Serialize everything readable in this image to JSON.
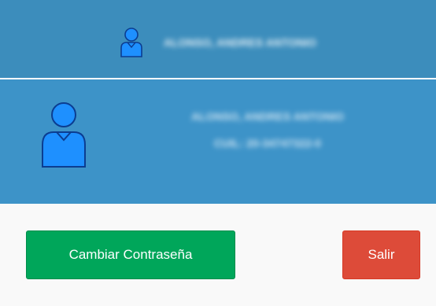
{
  "navbar": {
    "user_name": "ALONSO, ANDRES ANTONIO",
    "avatar_icon": "user-icon"
  },
  "user_header": {
    "name": "ALONSO, ANDRES ANTONIO",
    "cuil": "CUIL: 20-34747322-0",
    "avatar_icon": "user-icon"
  },
  "footer": {
    "change_password_label": "Cambiar Contraseña",
    "logout_label": "Salir"
  },
  "colors": {
    "navbar": "#3c8dbc",
    "header": "#3d93c8",
    "success": "#00a65a",
    "danger": "#dd4b39"
  }
}
